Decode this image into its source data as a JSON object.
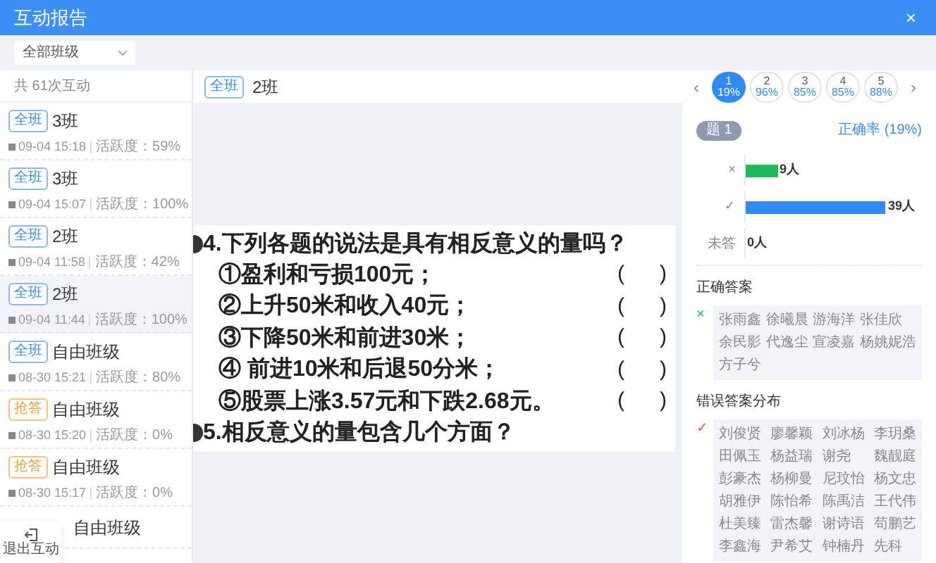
{
  "window": {
    "title": "互动报告",
    "close": "×"
  },
  "filter": {
    "value": "全部班级"
  },
  "list": {
    "count": "共 61次互动",
    "items": [
      {
        "tag": "全班",
        "kind": "class",
        "title": "3班",
        "time": "09-04 15:18",
        "activity": "活跃度：59%",
        "selected": false
      },
      {
        "tag": "全班",
        "kind": "class",
        "title": "3班",
        "time": "09-04 15:07",
        "activity": "活跃度：100%",
        "selected": false
      },
      {
        "tag": "全班",
        "kind": "class",
        "title": "2班",
        "time": "09-04 11:58",
        "activity": "活跃度：42%",
        "selected": false
      },
      {
        "tag": "全班",
        "kind": "class",
        "title": "2班",
        "time": "09-04 11:44",
        "activity": "活跃度：100%",
        "selected": true
      },
      {
        "tag": "全班",
        "kind": "class",
        "title": "自由班级",
        "time": "08-30 15:21",
        "activity": "活跃度：80%",
        "selected": false
      },
      {
        "tag": "抢答",
        "kind": "race",
        "title": "自由班级",
        "time": "08-30 15:20",
        "activity": "活跃度：0%",
        "selected": false
      },
      {
        "tag": "抢答",
        "kind": "race",
        "title": "自由班级",
        "time": "08-30 15:17",
        "activity": "活跃度：0%",
        "selected": false
      },
      {
        "title": "自由班级",
        "selected": false
      }
    ]
  },
  "exit_button": {
    "label": "退出互动"
  },
  "header": {
    "tag": "全班",
    "title": "2班"
  },
  "question_nav": {
    "prev": "‹",
    "next": "›",
    "items": [
      {
        "number": "1",
        "rate": "19%",
        "selected": true
      },
      {
        "number": "2",
        "rate": "96%",
        "selected": false
      },
      {
        "number": "3",
        "rate": "85%",
        "selected": false
      },
      {
        "number": "4",
        "rate": "85%",
        "selected": false
      },
      {
        "number": "5",
        "rate": "88%",
        "selected": false
      }
    ]
  },
  "document": {
    "lines": [
      {
        "kind": "question",
        "text": "4.下列各题的说法是具有相反意义的量吗？"
      },
      {
        "kind": "item",
        "text": "①盈利和亏损100元；",
        "blank": "(      )"
      },
      {
        "kind": "item",
        "text": "②上升50米和收入40元；",
        "blank": "(      )"
      },
      {
        "kind": "item",
        "text": "③下降50米和前进30米；",
        "blank": "(      )"
      },
      {
        "kind": "item",
        "text": "④ 前进10米和后退50分米；",
        "blank": "(      )"
      },
      {
        "kind": "item",
        "text": "⑤股票上涨3.57元和下跌2.68元。",
        "blank": "(      )"
      },
      {
        "kind": "question",
        "text": "5.相反意义的量包含几个方面？"
      }
    ]
  },
  "result": {
    "question": "题 1",
    "accuracy": "正确率 (19%)",
    "bars": [
      {
        "label": "×",
        "color": "#1fb95a",
        "level": 0.23,
        "reading": "9人"
      },
      {
        "label": "✓",
        "color": "#2f8af5",
        "level": 1,
        "reading": "39人"
      },
      {
        "label": "未答",
        "level": 0,
        "reading": "0人"
      }
    ],
    "groups": [
      {
        "title": "正确答案",
        "mark": "×",
        "color": "#1fb95a",
        "names": [
          "张雨鑫",
          "徐曦晨",
          "游海洋",
          "张佳欣",
          "余民影",
          "代逸尘",
          "宣凌嘉",
          "杨姚妮浩",
          "方子兮"
        ]
      },
      {
        "title": "错误答案分布",
        "mark": "✓",
        "color": "#e4604c",
        "names": [
          "刘俊贤",
          "廖馨颖",
          "刘冰杨",
          "李玥桑",
          "田佩玉",
          "杨益瑞",
          "谢尧",
          "魏靓庭",
          "彭豪杰",
          "杨柳曼",
          "尼玟怡",
          "杨文忠",
          "胡雅伊",
          "陈怡希",
          "陈禹洁",
          "王代伟",
          "杜美臻",
          "雷杰馨",
          "谢诗语",
          "苟鹏艺",
          "李鑫海",
          "尹希艾",
          "钟楠丹",
          "先科"
        ]
      }
    ]
  }
}
